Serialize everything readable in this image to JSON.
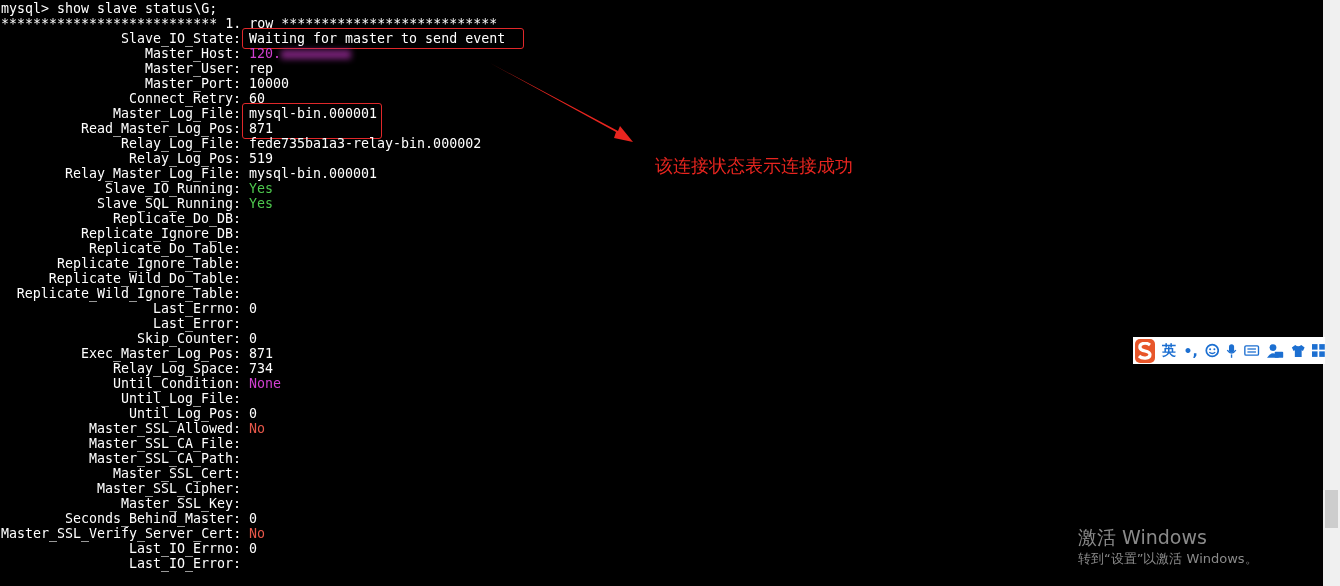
{
  "terminal": {
    "command_line": "mysql> show slave status\\G;",
    "separator": "*************************** 1. row ***************************",
    "rows": [
      {
        "label": "Slave_IO_State:",
        "value": "Waiting for master to send event",
        "color": "#ffffff",
        "boxed": true
      },
      {
        "label": "Master_Host:",
        "value": "120.",
        "color": "#d040d0",
        "redacted": true
      },
      {
        "label": "Master_User:",
        "value": "rep",
        "color": "#ffffff"
      },
      {
        "label": "Master_Port:",
        "value": "10000",
        "color": "#ffffff"
      },
      {
        "label": "Connect_Retry:",
        "value": "60",
        "color": "#ffffff"
      },
      {
        "label": "Master_Log_File:",
        "value": "mysql-bin.000001",
        "color": "#ffffff",
        "boxed": true
      },
      {
        "label": "Read_Master_Log_Pos:",
        "value": "871",
        "color": "#ffffff",
        "boxed": true
      },
      {
        "label": "Relay_Log_File:",
        "value": "fede735ba1a3-relay-bin.000002",
        "color": "#ffffff"
      },
      {
        "label": "Relay_Log_Pos:",
        "value": "519",
        "color": "#ffffff"
      },
      {
        "label": "Relay_Master_Log_File:",
        "value": "mysql-bin.000001",
        "color": "#ffffff"
      },
      {
        "label": "Slave_IO_Running:",
        "value": "Yes",
        "color": "#4ec94e"
      },
      {
        "label": "Slave_SQL_Running:",
        "value": "Yes",
        "color": "#4ec94e"
      },
      {
        "label": "Replicate_Do_DB:"
      },
      {
        "label": "Replicate_Ignore_DB:"
      },
      {
        "label": "Replicate_Do_Table:"
      },
      {
        "label": "Replicate_Ignore_Table:"
      },
      {
        "label": "Replicate_Wild_Do_Table:"
      },
      {
        "label": "Replicate_Wild_Ignore_Table:"
      },
      {
        "label": "Last_Errno:",
        "value": "0",
        "color": "#ffffff"
      },
      {
        "label": "Last_Error:"
      },
      {
        "label": "Skip_Counter:",
        "value": "0",
        "color": "#ffffff"
      },
      {
        "label": "Exec_Master_Log_Pos:",
        "value": "871",
        "color": "#ffffff"
      },
      {
        "label": "Relay_Log_Space:",
        "value": "734",
        "color": "#ffffff"
      },
      {
        "label": "Until_Condition:",
        "value": "None",
        "color": "#d040d0"
      },
      {
        "label": "Until_Log_File:"
      },
      {
        "label": "Until_Log_Pos:",
        "value": "0",
        "color": "#ffffff"
      },
      {
        "label": "Master_SSL_Allowed:",
        "value": "No",
        "color": "#e8584a"
      },
      {
        "label": "Master_SSL_CA_File:"
      },
      {
        "label": "Master_SSL_CA_Path:"
      },
      {
        "label": "Master_SSL_Cert:"
      },
      {
        "label": "Master_SSL_Cipher:"
      },
      {
        "label": "Master_SSL_Key:"
      },
      {
        "label": "Seconds_Behind_Master:",
        "value": "0",
        "color": "#ffffff"
      },
      {
        "label": "Master_SSL_Verify_Server_Cert:",
        "value": "No",
        "color": "#e8584a"
      },
      {
        "label": "Last_IO_Errno:",
        "value": "0",
        "color": "#ffffff"
      },
      {
        "label": "Last_IO_Error:"
      }
    ]
  },
  "annotation": {
    "text": "该连接状态表示连接成功"
  },
  "ime_toolbar": {
    "language": "英",
    "punctuation": "•,"
  },
  "activation_notice": {
    "title": "激活 Windows",
    "subtitle": "转到“设置”以激活 Windows。"
  }
}
